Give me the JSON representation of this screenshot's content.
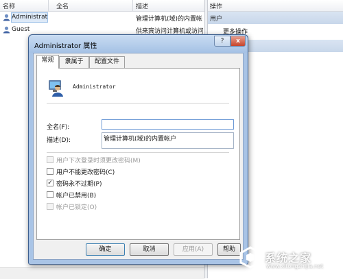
{
  "list": {
    "columns": [
      "名称",
      "全名",
      "描述"
    ],
    "rows": [
      {
        "name": "Administrat...",
        "full_name": "",
        "description": "管理计算机(域)的内置帐"
      },
      {
        "name": "Guest",
        "full_name": "",
        "description": "供来宾访问计算机或访问"
      }
    ]
  },
  "actions": {
    "header": "操作",
    "group": "用户",
    "more": "更多操作"
  },
  "dialog": {
    "title": "Administrator 属性",
    "help_glyph": "?",
    "close_glyph": "x",
    "tabs": [
      "常规",
      "隶属于",
      "配置文件"
    ],
    "user_name": "Administrator",
    "full_name_label": "全名(F):",
    "full_name_value": "",
    "description_label": "描述(D):",
    "description_value": "管理计算机(域)的内置帐户",
    "checkboxes": [
      {
        "label": "用户下次登录时须更改密码(M)",
        "checked": false,
        "disabled": true
      },
      {
        "label": "用户不能更改密码(C)",
        "checked": false,
        "disabled": false
      },
      {
        "label": "密码永不过期(P)",
        "checked": true,
        "disabled": false
      },
      {
        "label": "帐户已禁用(B)",
        "checked": false,
        "disabled": false
      },
      {
        "label": "帐户已锁定(O)",
        "checked": false,
        "disabled": true
      }
    ],
    "buttons": {
      "ok": "确定",
      "cancel": "取消",
      "apply": "应用(A)",
      "help": "帮助"
    },
    "check_glyph": "✓"
  },
  "watermark": {
    "text": "系统之家",
    "url": "www.xitongzhijia.net"
  },
  "colors": {
    "titlebar": "#a5c2e5",
    "actions_group": "#c8d7ea",
    "selection": "#dde9f7"
  }
}
